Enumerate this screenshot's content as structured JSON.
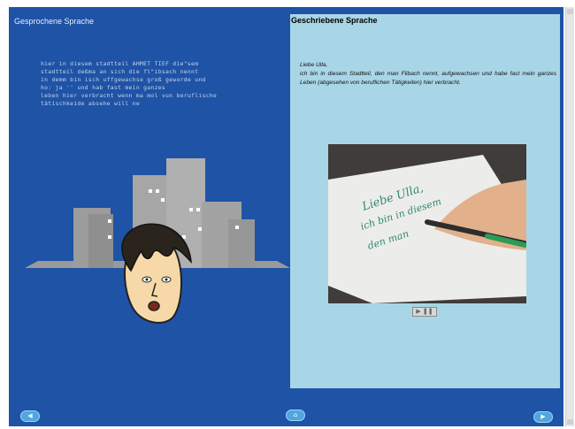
{
  "left_panel": {
    "title": "Gesprochene Sprache",
    "transcript": "hier in diesem stadtteil AHMET TIEF die\"sem\nstadtteil deßma an sich die fl\"ibsach nennt\nin demm bin isch uffgewachse groß geworde und\nho: ja '' und hab fast mein ganzes\nleben hier verbracht wenn ma mol vun beruflische\ntätischkeide absehe will ne"
  },
  "right_panel": {
    "title": "Geschriebene Sprache",
    "greeting": "Liebe Ulla,",
    "body": "ich bin in diesem Stadtteil, den man Flibach nennt, aufgewachsen und habe fast mein ganzes Leben (abgesehen von beruflichen Tätigkeiten) hier verbracht.",
    "play_label": "▶ ❚❚"
  },
  "video": {
    "handwriting": [
      "Liebe Ulla,",
      "ich bin in diesem",
      "den man"
    ]
  },
  "nav": {
    "back_label": "◀",
    "home_label": "⌂",
    "forward_label": "▶"
  }
}
